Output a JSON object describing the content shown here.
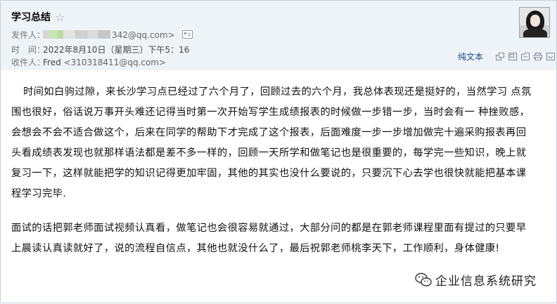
{
  "mail": {
    "subject": "学习总结",
    "sender_label": "发件人：",
    "sender_email_visible": "342@qq.com>",
    "time_label": "时　间：",
    "time_value": "2022年8月10日（星期三）下午5：16",
    "recipient_label": "收件人：",
    "recipient_name": "Fred",
    "recipient_email": "<310318411@qq.com>"
  },
  "toolbar": {
    "plaintext_label": "纯文本",
    "icons": [
      "new-window-icon",
      "restore-icon",
      "save-icon",
      "print-icon",
      "expand-icon"
    ]
  },
  "body": {
    "paragraph1": "时间如白驹过隙，来长沙学习点已经过了六个月了，回顾过去的六个月，我总体表现还是挺好的，当然学习 点氛围也很好，俗话说万事开头难还记得当时第一次开始写学生成绩报表的时候做一步错一步，当时会有一 种挫败感，会想会不会不适合做这个，后来在同学的帮助下才完成了这个报表，后面难度一步一步增加做完十遍采购报表再回头看成绩表发现也就那样语法都是差不多一样的，回顾一天所学和做笔记也是很重要的，每学完一些知识，晚上就复习一下，这样就能把学的知识记得更加牢固，其他的其实也没什么要说的，只要沉下心去学也很快就能把基本课程学习完毕.",
    "paragraph2": "面试的话把郭老师面试视频认真看，做笔记也会很容易就通过，大部分问的都是在郭老师课程里面有提过的只要早上晨读认真读就好了，说的流程自信点，其他也就没什么了，最后祝郭老师桃李天下，工作顺利，身体健康!"
  },
  "watermark": {
    "text": "企业信息系统研究",
    "icon": "wechat-icon"
  },
  "colors": {
    "header_bg": "#eef3f8",
    "border": "#c5cfd9",
    "link": "#1a4a8a"
  }
}
